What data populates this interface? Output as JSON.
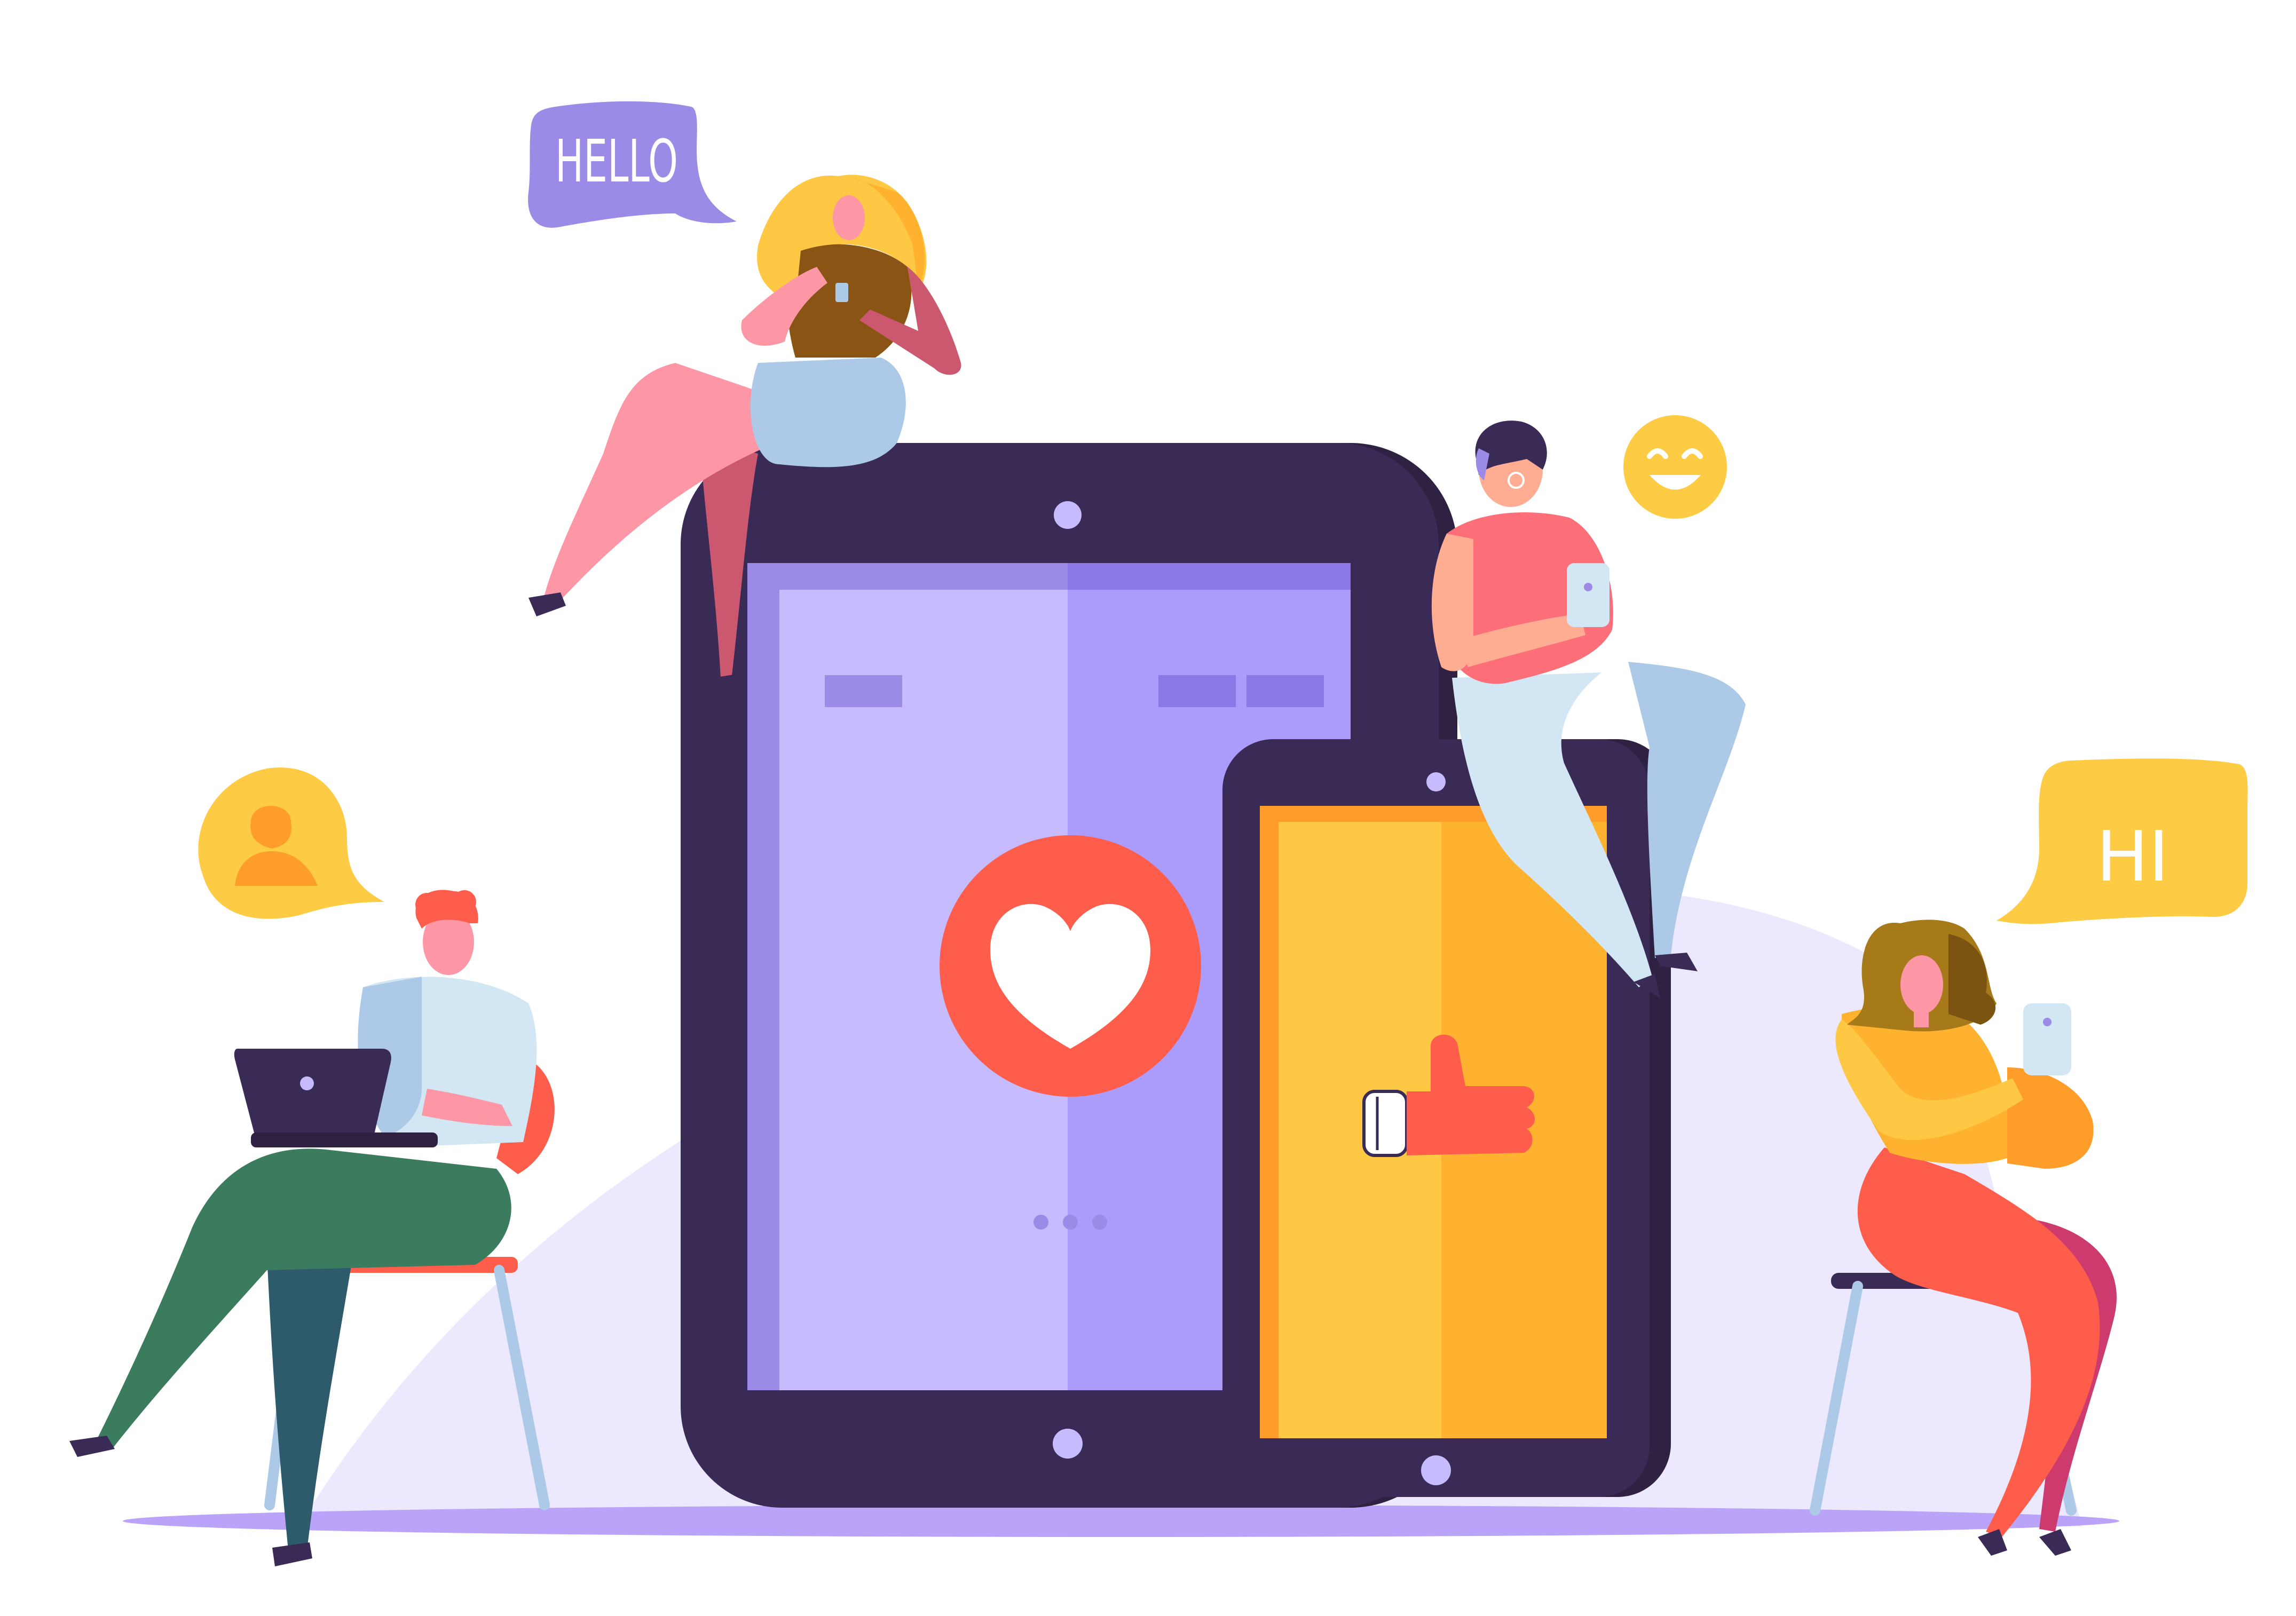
{
  "speech_bubbles": {
    "hello": "HELLO",
    "hi": "HI"
  },
  "icons": {
    "heart": "heart-icon",
    "thumbs_up": "thumbs-up-icon",
    "smile": "smile-emoji-icon",
    "user": "user-avatar-icon"
  },
  "colors": {
    "device_dark": "#3a2a56",
    "screen_light_purple": "#c6bbfd",
    "screen_purple": "#ab9bfb",
    "phone_yellow": "#fec845",
    "phone_orange": "#feb22f",
    "heart_red": "#fe5d4c",
    "bubble_purple": "#9c8ae7",
    "bubble_yellow": "#fecb45",
    "floor_lavender": "#b9a4f9",
    "background_blob": "#ece8fd"
  }
}
